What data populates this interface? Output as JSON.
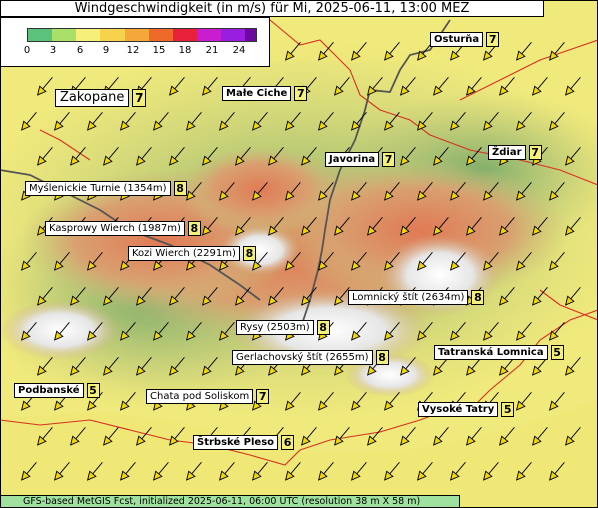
{
  "title": "Windgeschwindigkeit (in m/s) für Mi, 2025-06-11, 13:00 MEZ",
  "legend": {
    "ticks": [
      "0",
      "3",
      "6",
      "9",
      "12",
      "15",
      "18",
      "21",
      "24"
    ],
    "colors": [
      "#5ac27a",
      "#a8e06a",
      "#f5f07a",
      "#f7d24c",
      "#f5a83a",
      "#ee6a2a",
      "#e8203a",
      "#c81ecf",
      "#9a1ee0",
      "#6a0aa0"
    ]
  },
  "places": [
    {
      "name": "Osturňa",
      "value": "7",
      "kind": "town"
    },
    {
      "name": "Zakopane",
      "value": "7",
      "kind": "big"
    },
    {
      "name": "Małe Ciche",
      "value": "7",
      "kind": "town"
    },
    {
      "name": "Javorina",
      "value": "7",
      "kind": "town"
    },
    {
      "name": "Ždiar",
      "value": "7",
      "kind": "town"
    },
    {
      "name": "Myślenickie Turnie (1354m)",
      "value": "8",
      "kind": "peak"
    },
    {
      "name": "Kasprowy Wierch (1987m)",
      "value": "8",
      "kind": "peak"
    },
    {
      "name": "Kozi Wierch (2291m)",
      "value": "8",
      "kind": "peak"
    },
    {
      "name": "Lomnický štít (2634m)",
      "value": "8",
      "kind": "peak"
    },
    {
      "name": "Rysy (2503m)",
      "value": "8",
      "kind": "peak"
    },
    {
      "name": "Gerlachovský štít (2655m)",
      "value": "8",
      "kind": "peak"
    },
    {
      "name": "Tatranská Lomnica",
      "value": "5",
      "kind": "town"
    },
    {
      "name": "Podbanské",
      "value": "5",
      "kind": "town"
    },
    {
      "name": "Chata pod Soliskom",
      "value": "7",
      "kind": "peak"
    },
    {
      "name": "Vysoké Tatry",
      "value": "5",
      "kind": "town"
    },
    {
      "name": "Štrbské Pleso",
      "value": "6",
      "kind": "town"
    }
  ],
  "footer": "GFS-based MetGIS Fcst, initialized 2025-06-11, 06:00 UTC  (resolution 38 m X 58 m)"
}
